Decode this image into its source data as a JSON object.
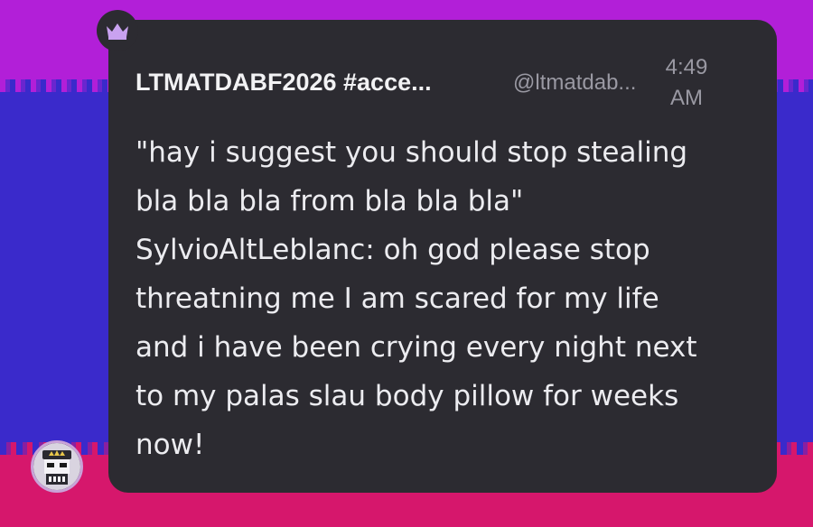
{
  "message": {
    "author_name": "LTMATDABF2026 #acce...",
    "author_handle": "@ltmatdab...",
    "time_line1": "4:49",
    "time_line2": "AM",
    "body_lines": [
      "\"hay i suggest you should stop stealing",
      "bla bla bla from bla bla bla\"",
      "SylvioAltLeblanc: oh god please stop",
      "threatning me I am scared for my life",
      "and i have been crying every night next",
      "to my palas slau body pillow for weeks",
      "now!"
    ]
  },
  "badge": {
    "icon": "crown-icon",
    "color": "#c9a2f0"
  },
  "avatar": {
    "icon": "avatar-image"
  },
  "colors": {
    "bubble": "#2c2b31",
    "stripe_top": "#b21fd8",
    "stripe_mid": "#3a2acb",
    "stripe_bottom": "#d6176c",
    "name_text": "#f2f2f4",
    "meta_text": "#9a99a3"
  }
}
